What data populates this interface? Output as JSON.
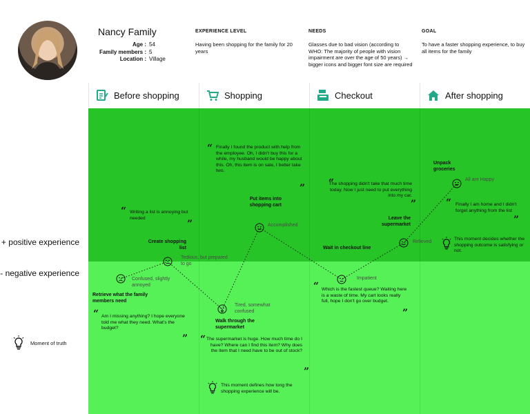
{
  "persona": {
    "name": "Nancy Family",
    "facts": [
      {
        "key": "Age :",
        "value": "54"
      },
      {
        "key": "Family members :",
        "value": "5"
      },
      {
        "key": "Location :",
        "value": "Village"
      }
    ],
    "experience": {
      "title": "EXPERIENCE LEVEL",
      "text": "Having been shopping for the family for 20 years"
    },
    "needs": {
      "title": "NEEDS",
      "text": "Glasses due to bad vision (according to WHO: The majority of people with vision impairment are over the age of 50 years) → bigger icons and bigger font size are required"
    },
    "goal": {
      "title": "GOAL",
      "text": "To have a faster shopping experience, to buy all items for the family"
    }
  },
  "stages": [
    {
      "label": "Before shopping",
      "icon": "checklist-icon"
    },
    {
      "label": "Shopping",
      "icon": "cart-icon"
    },
    {
      "label": "Checkout",
      "icon": "cash-register-icon"
    },
    {
      "label": "After shopping",
      "icon": "home-icon"
    }
  ],
  "axis": {
    "positive": "+ positive experience",
    "negative": "- negative experience"
  },
  "legend": {
    "moment": "Moment of truth"
  },
  "colors": {
    "positive": "#27c427",
    "negative": "#56f156",
    "line": "#1a1a1a"
  },
  "quotes": {
    "q1": "Writing a list is annoying but needed",
    "q2": "Am I missing anything? I hope everyone told me what they need. What's the budget?",
    "q3": "Finally I found the product with help from the employee. Oh, I didn't buy this for a while, my husband would be happy about this. Oh, this item is on sale, I better take two.",
    "q4": "The supermarket is huge. How much time do I have? Where can I find this item? Why does the item that I need have to be out of stock?",
    "q5": "The shopping didn't take that much time today. Now I just need to put everything into my car.",
    "q6": "Which is the fastest queue? Waiting here is a waste of time. My cart looks really full, hope I don't go over budget.",
    "q7": "Finally I am home and I didn't forget anything from the list"
  },
  "moments": {
    "m1": "This moment defines how long the shopping experience will be.",
    "m2": "This moment decides whether the shopping outcome is satisfying or not."
  },
  "journey": {
    "points": [
      {
        "id": "p1",
        "action": "Retrieve what the family members need",
        "emotion": "Confused, slightly annoyed",
        "face": "sad-face-icon"
      },
      {
        "id": "p2",
        "action": "Create shopping list",
        "emotion": "Tedious, but prepared to go",
        "face": "neutral-face-icon"
      },
      {
        "id": "p3",
        "action": "Walk through the supermarket",
        "emotion": "Tired, somewhat confused",
        "face": "tired-face-icon"
      },
      {
        "id": "p4",
        "action": "Put items into shopping cart",
        "emotion": "Accomplished",
        "face": "smile-face-icon"
      },
      {
        "id": "p5",
        "action": "Wait in checkout line",
        "emotion": "Impatient",
        "face": "neutral-face-icon"
      },
      {
        "id": "p6",
        "action": "Leave the supermarket",
        "emotion": "Relieved",
        "face": "smile-face-icon"
      },
      {
        "id": "p7",
        "action": "Unpack groceries",
        "emotion": "All are Happy",
        "face": "happy-face-icon"
      }
    ]
  }
}
